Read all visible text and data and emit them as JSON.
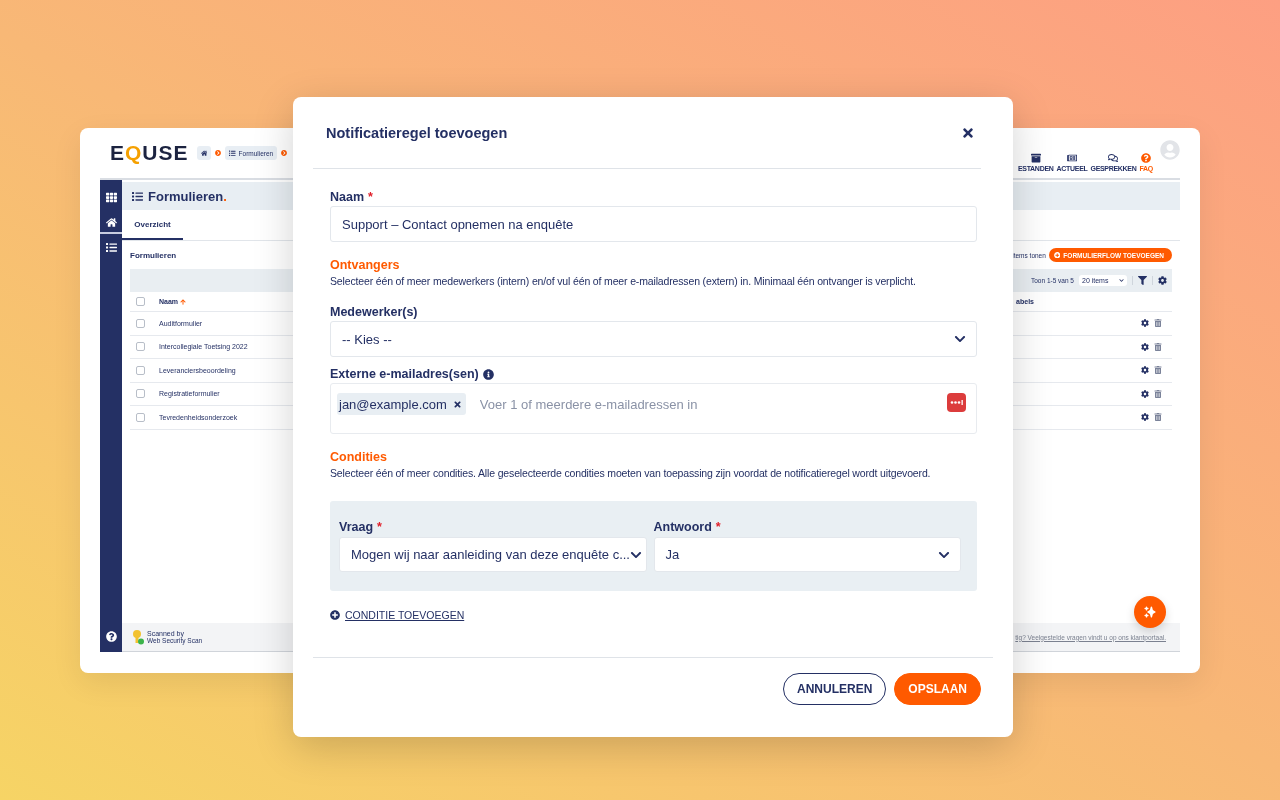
{
  "app": {
    "logo": [
      {
        "text": "E",
        "accent": false
      },
      {
        "text": "Q",
        "accent": true
      },
      {
        "text": "USE",
        "accent": false
      }
    ],
    "breadcrumbs": [
      {
        "kind": "home"
      },
      {
        "kind": "page",
        "label": "Formulieren"
      }
    ],
    "toolbar": [
      {
        "kind": "archive",
        "label": "ESTANDEN",
        "highlighted": false
      },
      {
        "kind": "news",
        "label": "ACTUEEL",
        "highlighted": false
      },
      {
        "kind": "chat",
        "label": "GESPREKKEN",
        "highlighted": false
      },
      {
        "kind": "faq",
        "label": "FAQ",
        "highlighted": true
      }
    ],
    "sidebar": {
      "items": [
        {
          "kind": "grid",
          "selected": false
        },
        {
          "kind": "home",
          "selected": true
        },
        {
          "kind": "list",
          "selected": false
        }
      ]
    },
    "page_title": "Formulieren",
    "title_dot": ".",
    "tabs": [
      {
        "label": "Overzicht",
        "selected": true
      }
    ],
    "section_title": "Formulieren",
    "items_text": "items tonen",
    "add_button": "FORMULIERFLOW TOEVOEGEN",
    "pager": "Toon 1-5 van 5",
    "page_size": "20 items",
    "table": {
      "all_checked": false,
      "columns": [
        {
          "label": "Naam",
          "sorted": true
        },
        {
          "label": "abels"
        }
      ],
      "rows": [
        {
          "name": "Auditformulier",
          "checked": false
        },
        {
          "name": "Intercollegiale Toetsing 2022",
          "checked": false
        },
        {
          "name": "Leveranciersbeoordeling",
          "checked": false
        },
        {
          "name": "Registratieformulier",
          "checked": false
        },
        {
          "name": "Tevredenheidsonderzoek",
          "checked": false
        }
      ]
    },
    "footer": {
      "badge_caption": "Scanned by",
      "badge_title": "Web Security Scan",
      "link": "tig? Veelgestelde vragen vindt u op ons klantportaal."
    }
  },
  "dialog": {
    "title": "Notificatieregel toevoegen",
    "name_field": {
      "label": "Naam",
      "required_mark": "*",
      "value": "Support – Contact opnemen na enquête"
    },
    "recipients": {
      "heading": "Ontvangers",
      "description": "Selecteer één of meer medewerkers (intern) en/of vul één of meer e-mailadressen (extern) in. Minimaal één ontvanger is verplicht.",
      "employees": {
        "label": "Medewerker(s)",
        "value": "-- Kies --"
      },
      "emails": {
        "label": "Externe e-mailadres(sen)",
        "tags": [
          "jan@example.com"
        ],
        "placeholder": "Voer 1 of meerdere e-mailadressen in"
      }
    },
    "conditions": {
      "heading": "Condities",
      "description": "Selecteer één of meer condities. Alle geselecteerde condities moeten van toepassing zijn voordat de notificatieregel wordt uitgevoerd.",
      "rows": [
        {
          "question_label": "Vraag",
          "question_mark": "*",
          "question": "Mogen wij naar aanleiding van deze enquête c...",
          "answer_label": "Antwoord",
          "answer_mark": "*",
          "answer": "Ja"
        }
      ],
      "add_link": "CONDITIE TOEVOEGEN"
    },
    "buttons": [
      {
        "kind": "secondary",
        "label": "ANNULEREN"
      },
      {
        "kind": "primary",
        "label": "OPSLAAN"
      }
    ]
  }
}
